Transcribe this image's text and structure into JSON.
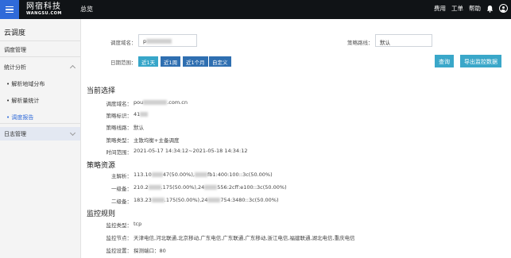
{
  "topbar": {
    "logo_cn": "网宿科技",
    "logo_en": "WANGSU.COM",
    "nav_overview": "总览",
    "right_links": [
      "费用",
      "工单",
      "帮助"
    ]
  },
  "sidebar": {
    "title": "云调度",
    "items": [
      {
        "label": "调度管理"
      },
      {
        "label": "统计分析"
      },
      {
        "label": "解析地域分布"
      },
      {
        "label": "解析量统计"
      },
      {
        "label": "调度报告"
      },
      {
        "label": "日志管理"
      }
    ]
  },
  "filter": {
    "domain_label": "调度域名：",
    "domain_value_prefix": "p",
    "policy_line_label": "策略路线：",
    "policy_line_value": "默认",
    "date_label": "日期范围：",
    "date_buttons": [
      "近1天",
      "近1周",
      "近1个月",
      "自定义"
    ],
    "query_button": "查询",
    "export_button": "导出监控数据"
  },
  "current": {
    "title": "当前选择",
    "rows": [
      {
        "label": "调度域名：",
        "pre": "pou",
        "post": ".com.cn"
      },
      {
        "label": "策略标识：",
        "pre": "41",
        "post": ""
      },
      {
        "label": "策略线路：",
        "pre": "默认",
        "post": ""
      },
      {
        "label": "策略类型：",
        "pre": "主散均衡+主备调度",
        "post": ""
      },
      {
        "label": "时间范围：",
        "pre": "2021-05-17 14:34:12~2021-05-18 14:34:12",
        "post": ""
      }
    ]
  },
  "resources": {
    "title": "策略资源",
    "rows": [
      {
        "label": "主解析：",
        "a": "113.10",
        "b": "47(50.00%),",
        "c": "fb1:400:100::3c(50.00%)"
      },
      {
        "label": "一级备：",
        "a": "210.2",
        "b": ".175(50.00%),24",
        "c": "556:2cff:e100::3c(50.00%)"
      },
      {
        "label": "二级备：",
        "a": "183.23",
        "b": ".175(50.00%),24",
        "c": "754:3480::3c(50.00%)"
      }
    ]
  },
  "monitor": {
    "title": "监控规则",
    "rows": [
      {
        "label": "监控类型：",
        "value": "tcp"
      },
      {
        "label": "监控节点：",
        "value": "天津电信,河北联通,北京移动,广东电信,广东联通,广东移动,浙江电信,福建联通,湖北电信,重庆电信"
      },
      {
        "label": "监控设置：",
        "value": "探测端口：80"
      }
    ]
  }
}
